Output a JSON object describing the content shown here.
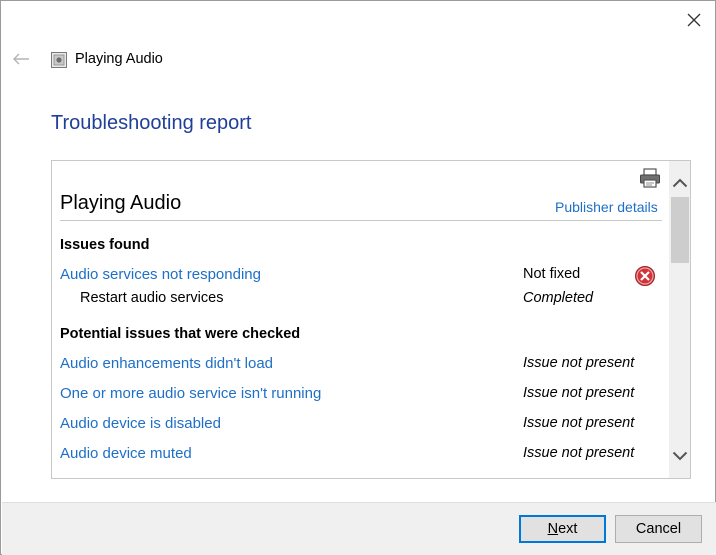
{
  "window": {
    "title": "Playing Audio",
    "close_icon": "close-icon",
    "back_icon": "back-arrow-icon"
  },
  "heading": "Troubleshooting report",
  "report": {
    "title": "Playing Audio",
    "publisher_link": "Publisher details",
    "print_icon": "printer-icon",
    "issues_found_heading": "Issues found",
    "issues_found": [
      {
        "label": "Audio services not responding",
        "status": "Not fixed",
        "status_icon": "error-icon"
      }
    ],
    "issue_steps": [
      {
        "label": "Restart audio services",
        "status": "Completed"
      }
    ],
    "checked_heading": "Potential issues that were checked",
    "checked": [
      {
        "label": "Audio enhancements didn't load",
        "status": "Issue not present"
      },
      {
        "label": "One or more audio service isn't running",
        "status": "Issue not present"
      },
      {
        "label": "Audio device is disabled",
        "status": "Issue not present"
      },
      {
        "label": "Audio device muted",
        "status": "Issue not present"
      }
    ]
  },
  "buttons": {
    "next_mnemonic": "N",
    "next_rest": "ext",
    "cancel": "Cancel"
  },
  "colors": {
    "link": "#1e6fc7",
    "heading": "#1f3f9a",
    "error": "#d13438",
    "accent": "#0078d7"
  }
}
